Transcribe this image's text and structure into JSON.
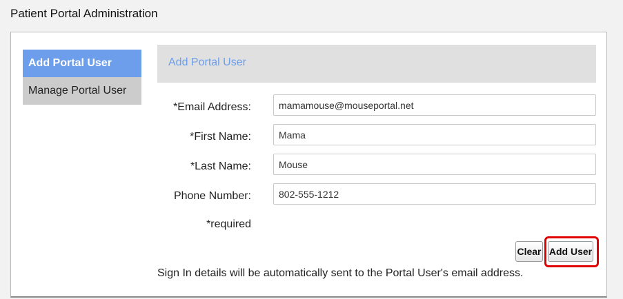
{
  "page": {
    "title": "Patient Portal Administration"
  },
  "sidebar": {
    "items": [
      {
        "label": "Add Portal User",
        "active": true
      },
      {
        "label": "Manage Portal User",
        "active": false
      }
    ]
  },
  "form": {
    "header": "Add Portal User",
    "fields": {
      "email": {
        "label": "*Email Address:",
        "value": "mamamouse@mouseportal.net"
      },
      "first_name": {
        "label": "*First Name:",
        "value": "Mama"
      },
      "last_name": {
        "label": "*Last Name:",
        "value": "Mouse"
      },
      "phone": {
        "label": "Phone Number:",
        "value": "802-555-1212"
      }
    },
    "required_note": "*required",
    "buttons": {
      "clear": "Clear",
      "add": "Add User"
    },
    "sign_in_note": "Sign In details will be automatically sent to the Portal User's email address."
  },
  "colors": {
    "accent": "#6d9eeb",
    "highlight": "#e00000",
    "sidebar_inactive": "#cccccc",
    "header_bg": "#e0e0e0"
  }
}
